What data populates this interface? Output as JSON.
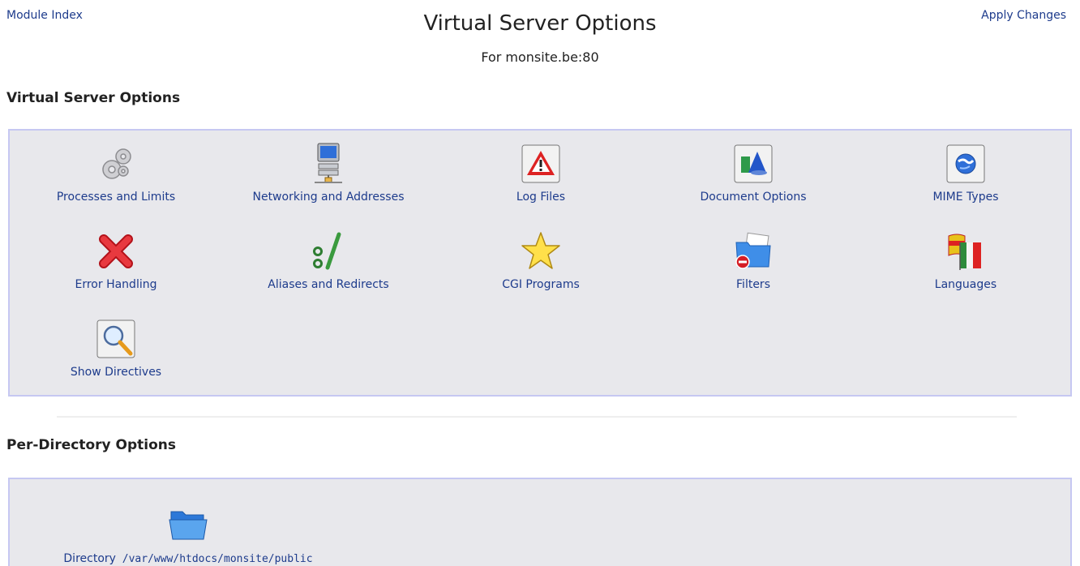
{
  "header": {
    "module_index": "Module Index",
    "apply_changes": "Apply Changes",
    "title": "Virtual Server Options",
    "subtitle": "For monsite.be:80"
  },
  "virtual_server": {
    "heading": "Virtual Server Options",
    "items": [
      {
        "label": "Processes and Limits",
        "icon": "gears-icon"
      },
      {
        "label": "Networking and Addresses",
        "icon": "network-computer-icon"
      },
      {
        "label": "Log Files",
        "icon": "warning-triangle-icon"
      },
      {
        "label": "Document Options",
        "icon": "document-shapes-icon"
      },
      {
        "label": "MIME Types",
        "icon": "globe-icon"
      },
      {
        "label": "Error Handling",
        "icon": "red-x-icon"
      },
      {
        "label": "Aliases and Redirects",
        "icon": "colon-slash-icon"
      },
      {
        "label": "CGI Programs",
        "icon": "star-icon"
      },
      {
        "label": "Filters",
        "icon": "folder-blocked-icon"
      },
      {
        "label": "Languages",
        "icon": "flags-icon"
      },
      {
        "label": "Show Directives",
        "icon": "magnifier-icon"
      }
    ]
  },
  "per_directory": {
    "heading": "Per-Directory Options",
    "items": [
      {
        "prefix": "Directory",
        "path": "/var/www/htdocs/monsite/public",
        "icon": "folder-icon"
      }
    ]
  }
}
